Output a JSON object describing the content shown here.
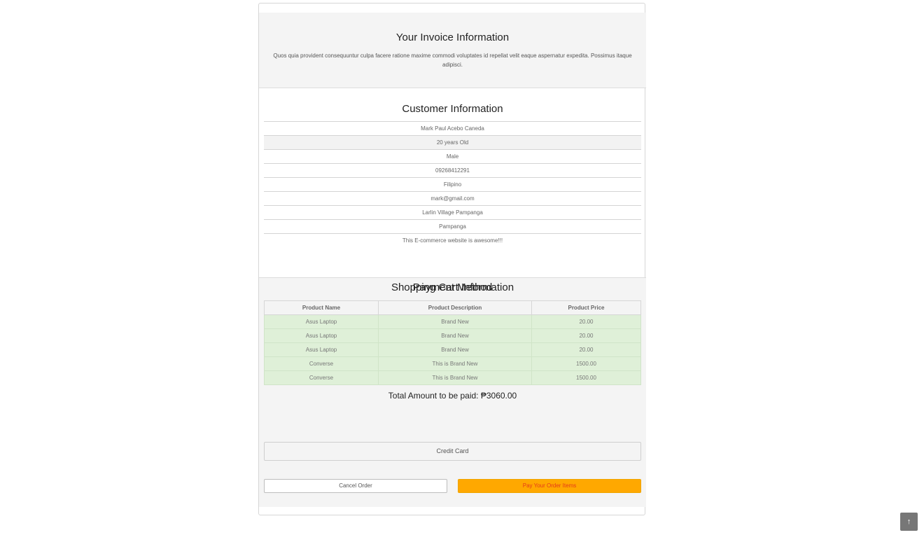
{
  "invoice": {
    "title": "Your Invoice Information",
    "description": "Quos quia provident consequuntur culpa facere ratione maxime commodi voluptates id repellat velit eaque aspernatur expedita. Possimus itaque adipisci."
  },
  "customer": {
    "title": "Customer Information",
    "name": "Mark Paul Acebo Caneda",
    "age": "20 years Old",
    "gender": "Male",
    "phone": "09268412291",
    "nationality": "Filipino",
    "email": "mark@gmail.com",
    "address": "Larlin Village Pampanga",
    "province": "Pampanga",
    "note": "This E-commerce website is awesome!!!"
  },
  "cart": {
    "title": "Shopping Cart Information",
    "columns": [
      "Product Name",
      "Product Description",
      "Product Price"
    ],
    "rows": [
      [
        "Asus Laptop",
        "Brand New",
        "20.00"
      ],
      [
        "Asus Laptop",
        "Brand New",
        "20.00"
      ],
      [
        "Asus Laptop",
        "Brand New",
        "20.00"
      ],
      [
        "Converse",
        "This is Brand New",
        "1500.00"
      ],
      [
        "Converse",
        "This is Brand New",
        "1500.00"
      ]
    ],
    "total": "Total Amount to be paid: ₱3060.00"
  },
  "payment": {
    "title": "Payment Method",
    "selected": "Credit Card"
  },
  "actions": {
    "cancel_label": "Cancel Order",
    "pay_label": "Pay Your Order Items"
  },
  "scroll_top": {
    "glyph": "↑"
  },
  "colors": {
    "accent_pay_button": "#ffa800",
    "pay_button_text": "#e53a1a",
    "cart_row_bg": "#dff0d8"
  }
}
